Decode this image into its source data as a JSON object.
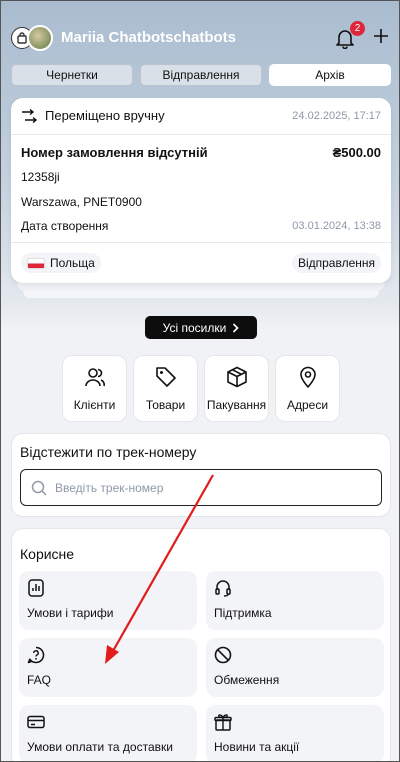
{
  "header": {
    "username": "Mariia Chatbotschatbots",
    "notifications_count": "2"
  },
  "tabs": [
    {
      "label": "Чернетки",
      "active": false
    },
    {
      "label": "Відправлення",
      "active": false
    },
    {
      "label": "Архів",
      "active": true
    }
  ],
  "shipment": {
    "moved_label": "Переміщено вручну",
    "moved_date": "24.02.2025, 17:17",
    "order_title": "Номер замовлення відсутній",
    "amount": "₴500.00",
    "code": "12358ji",
    "address": "Warszawa, PNET0900",
    "created_label": "Дата створення",
    "created_date": "03.01.2024, 13:38",
    "country": "Польща",
    "status": "Відправлення"
  },
  "all_parcels_label": "Усі посилки",
  "quick_tiles": [
    {
      "label": "Клієнти",
      "icon": "users-icon"
    },
    {
      "label": "Товари",
      "icon": "tag-icon"
    },
    {
      "label": "Пакування",
      "icon": "box-icon"
    },
    {
      "label": "Адреси",
      "icon": "map-pin-icon"
    }
  ],
  "track": {
    "title": "Відстежити по трек-номеру",
    "placeholder": "Введіть трек-номер"
  },
  "useful": {
    "title": "Корисне",
    "items": [
      {
        "label": "Умови і тарифи",
        "icon": "chart-doc-icon"
      },
      {
        "label": "Підтримка",
        "icon": "headset-icon"
      },
      {
        "label": "FAQ",
        "icon": "question-bubble-icon"
      },
      {
        "label": "Обмеження",
        "icon": "prohibited-icon"
      },
      {
        "label": "Умови оплати та доставки",
        "icon": "credit-card-icon"
      },
      {
        "label": "Новини та акції",
        "icon": "gift-icon"
      }
    ]
  },
  "colors": {
    "accent_red": "#e0253a",
    "annotation_arrow": "#e21b1b"
  }
}
